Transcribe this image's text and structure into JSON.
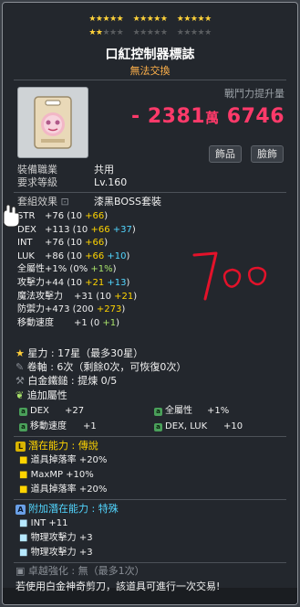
{
  "stars": {
    "filled": 17,
    "row1": [
      "★★★★★",
      "★★★★★",
      "★★★★★"
    ],
    "row2": [
      "★★",
      "★★★",
      "★★★★★",
      "★★★★★"
    ]
  },
  "item": {
    "name": "口紅控制器標誌",
    "trade": "無法交換"
  },
  "power": {
    "label": "戰鬥力提升量",
    "sign": "-",
    "value_big": "2381",
    "unit": "萬",
    "value_small": "6746"
  },
  "buttons": {
    "accessory": "飾品",
    "face": "臉飾"
  },
  "info": {
    "job_label": "裝備職業",
    "job": "共用",
    "level_label": "要求等級",
    "level": "Lv.160",
    "set_label": "套組效果",
    "set": "漆黑BOSS套裝"
  },
  "stats": [
    {
      "name": "STR",
      "total": "+76",
      "base": "10",
      "parts": [
        {
          "v": "+66",
          "cls": "y"
        }
      ]
    },
    {
      "name": "DEX",
      "total": "+113",
      "base": "10",
      "parts": [
        {
          "v": "+66",
          "cls": "y"
        },
        {
          "v": "+37",
          "cls": "c"
        }
      ]
    },
    {
      "name": "INT",
      "total": "+76",
      "base": "10",
      "parts": [
        {
          "v": "+66",
          "cls": "y"
        }
      ]
    },
    {
      "name": "LUK",
      "total": "+86",
      "base": "10",
      "parts": [
        {
          "v": "+66",
          "cls": "y"
        },
        {
          "v": "+10",
          "cls": "c"
        }
      ]
    },
    {
      "name": "全屬性",
      "total": "+1%",
      "base": "0%",
      "parts": [
        {
          "v": "+1%",
          "cls": "g"
        }
      ]
    },
    {
      "name": "攻擊力",
      "total": "+44",
      "base": "10",
      "parts": [
        {
          "v": "+21",
          "cls": "y"
        },
        {
          "v": "+13",
          "cls": "c"
        }
      ]
    },
    {
      "name": "魔法攻擊力",
      "total": "+31",
      "base": "10",
      "parts": [
        {
          "v": "+21",
          "cls": "y"
        }
      ]
    },
    {
      "name": "防禦力",
      "total": "+473",
      "base": "200",
      "parts": [
        {
          "v": "+273",
          "cls": "y"
        }
      ]
    },
    {
      "name": "移動速度",
      "total": "+1",
      "base": "0",
      "parts": [
        {
          "v": "+1",
          "cls": "g"
        }
      ]
    }
  ],
  "starforce": "星力 : 17星（最多30星）",
  "scroll": "卷軸 : 6次（剩餘0次，可恢復0次）",
  "platinum": "白金鐵鎚 : 提煉 0/5",
  "added": {
    "label": "追加屬性",
    "items": [
      {
        "t": "DEX",
        "v": "+27"
      },
      {
        "t": "全屬性",
        "v": "+1%"
      },
      {
        "t": "移動速度",
        "v": "+1"
      },
      {
        "t": "DEX, LUK",
        "v": "+10"
      }
    ]
  },
  "potential": {
    "label": "潛在能力 : 傳說",
    "lines": [
      "道具掉落率 +20%",
      "MaxMP +10%",
      "道具掉落率 +20%"
    ]
  },
  "additional": {
    "label": "附加潛在能力 : 特殊",
    "lines": [
      "INT +11",
      "物理攻擊力 +3",
      "物理攻擊力 +3"
    ]
  },
  "enhance": "卓越強化 : 無（最多1次）",
  "footer_note": "若使用白金神奇剪刀，該道具可進行一次交易!",
  "colors": {
    "power": "#ff3a6a",
    "gold": "#ffd400",
    "cyan": "#52d6ff",
    "green": "#a8e26a"
  }
}
